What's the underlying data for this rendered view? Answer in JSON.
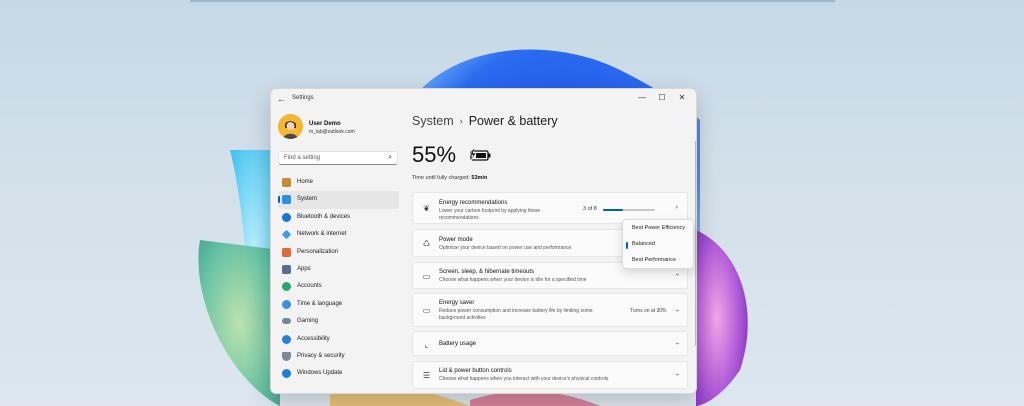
{
  "window": {
    "title": "Settings",
    "controls": {
      "minimize": "—",
      "maximize": "☐",
      "close": "✕"
    }
  },
  "profile": {
    "name": "User Demo",
    "email": "m_lab@outlook.com"
  },
  "search": {
    "placeholder": "Find a setting"
  },
  "sidebar": {
    "items": [
      {
        "label": "Home",
        "icon": "home-icon",
        "color": "#c48a3a"
      },
      {
        "label": "System",
        "icon": "system-icon",
        "color": "#2f8fd8",
        "active": true
      },
      {
        "label": "Bluetooth & devices",
        "icon": "bluetooth-icon",
        "color": "#1a73d9"
      },
      {
        "label": "Network & internet",
        "icon": "network-icon",
        "color": "#3aa0e8"
      },
      {
        "label": "Personalization",
        "icon": "brush-icon",
        "color": "#e06a3a"
      },
      {
        "label": "Apps",
        "icon": "apps-icon",
        "color": "#5a6b8c"
      },
      {
        "label": "Accounts",
        "icon": "accounts-icon",
        "color": "#2aa86a"
      },
      {
        "label": "Time & language",
        "icon": "time-language-icon",
        "color": "#3b8fe0"
      },
      {
        "label": "Gaming",
        "icon": "gaming-icon",
        "color": "#7a8796"
      },
      {
        "label": "Accessibility",
        "icon": "accessibility-icon",
        "color": "#2a7fd6"
      },
      {
        "label": "Privacy & security",
        "icon": "shield-icon",
        "color": "#7d8a99"
      },
      {
        "label": "Windows Update",
        "icon": "windows-update-icon",
        "color": "#1f7fd6"
      }
    ]
  },
  "main": {
    "breadcrumb_parent": "System",
    "breadcrumb_sep": "›",
    "page_title": "Power & battery",
    "battery_percent": "55%",
    "charge_label": "Time until fully charged:",
    "charge_time": "53min",
    "cards": {
      "energy_recommendations": {
        "title": "Energy recommendations",
        "desc": "Lower your carbon footprint by applying these recommendations",
        "progress_text": "3 of 8",
        "progress_fraction": 0.375
      },
      "power_mode": {
        "title": "Power mode",
        "desc": "Optimize your device based on power use and performance"
      },
      "screen_sleep": {
        "title": "Screen, sleep, & hibernate timeouts",
        "desc": "Choose what happens when your device is idle for a specified time"
      },
      "energy_saver": {
        "title": "Energy saver",
        "desc": "Reduce power consumption and increase battery life by limiting some background activities",
        "value": "Turns on at 30%"
      },
      "battery_usage": {
        "title": "Battery usage"
      },
      "lid_power": {
        "title": "Lid & power button controls",
        "desc": "Choose what happens when you interact with your device's physical controls"
      }
    },
    "power_mode_options": [
      "Best Power Efficiency",
      "Balanced",
      "Best Performance"
    ],
    "power_mode_selected": "Balanced"
  },
  "colors": {
    "accent": "#005fb8"
  }
}
